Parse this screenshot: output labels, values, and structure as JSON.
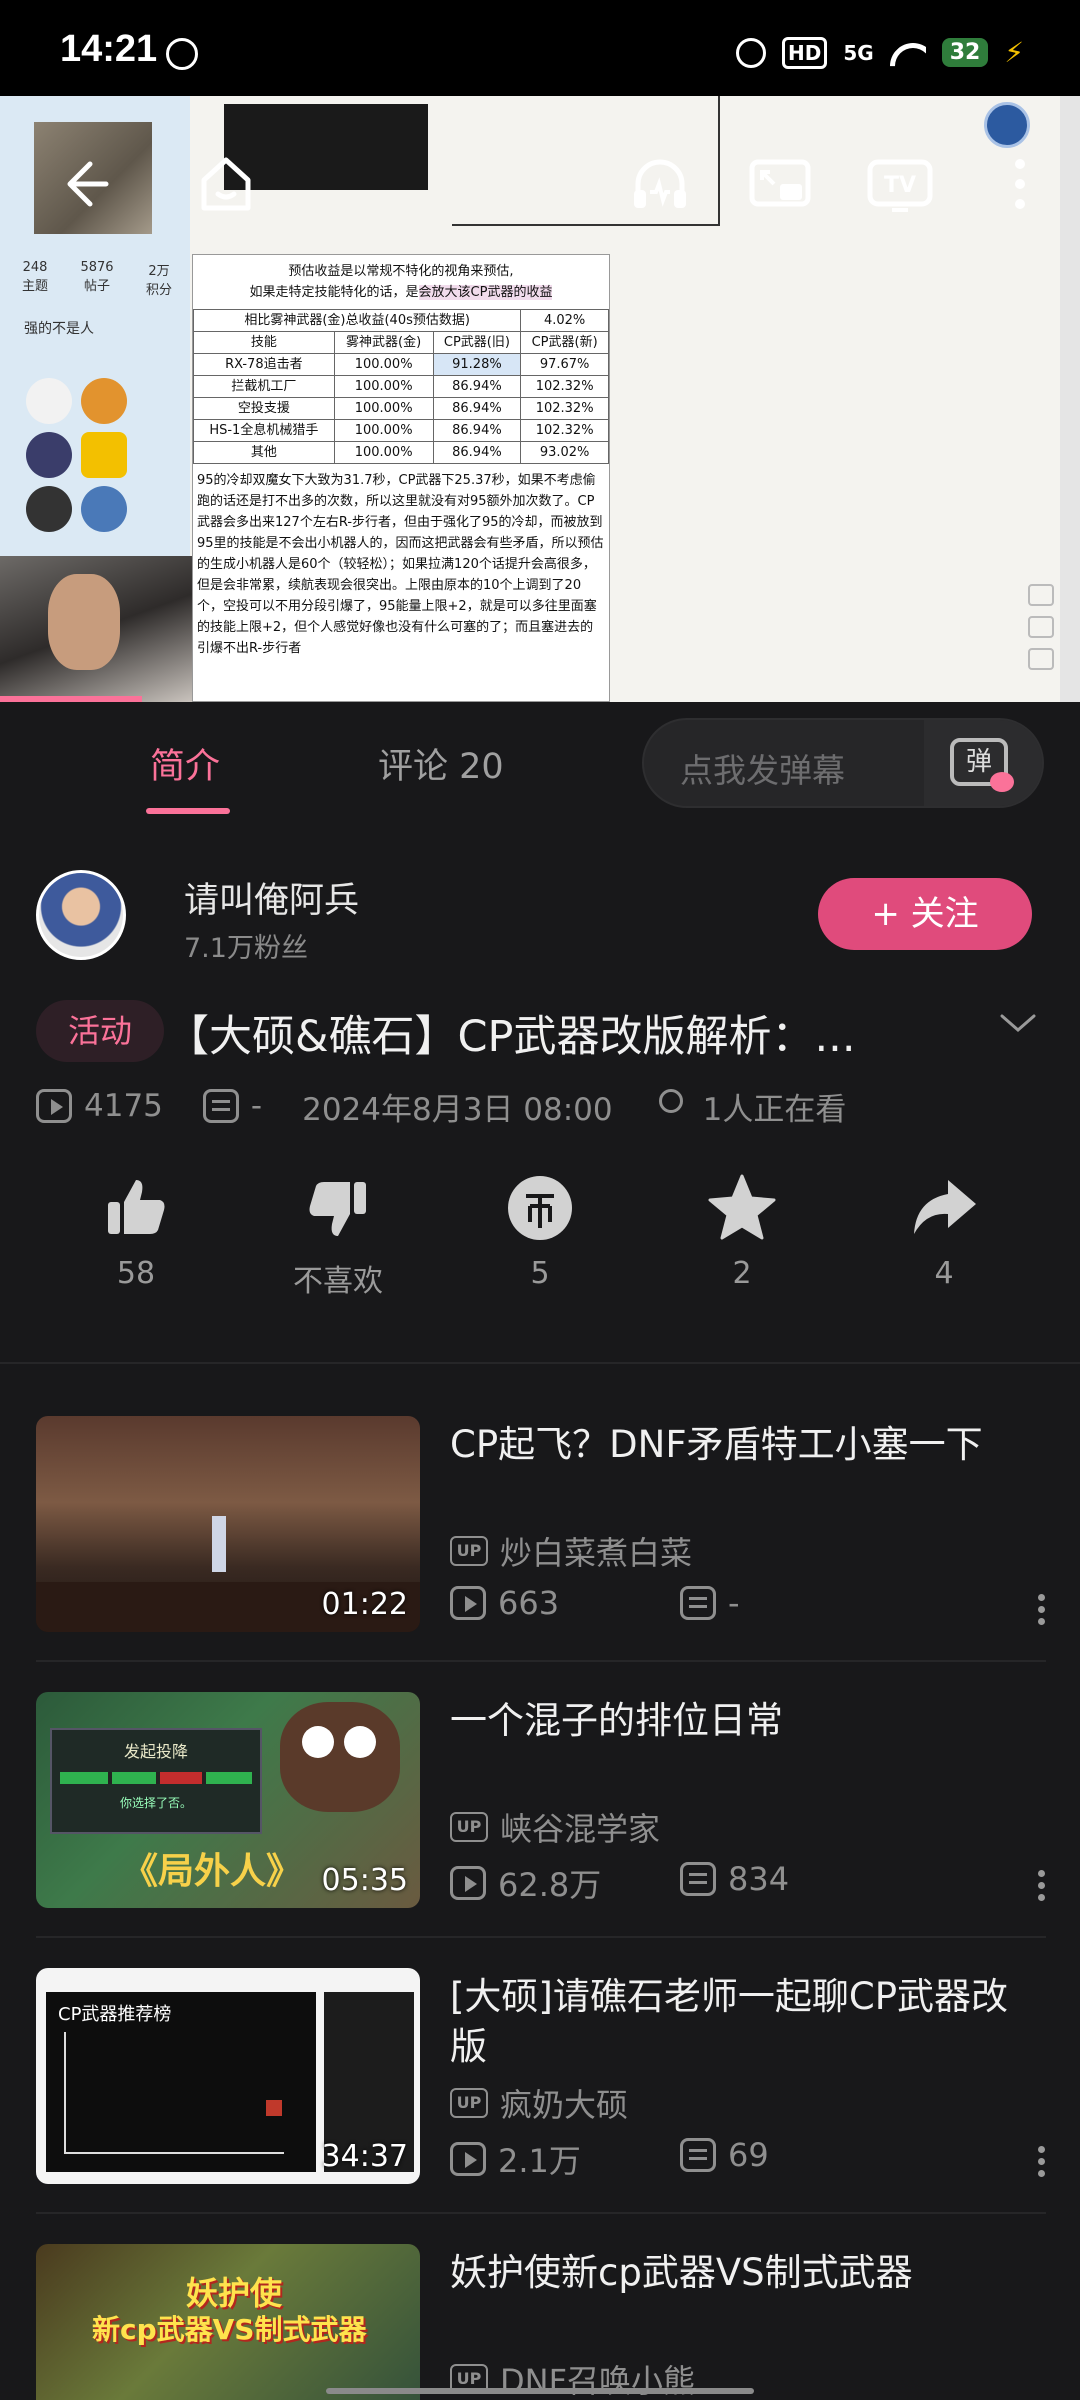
{
  "status_bar": {
    "time": "14:21",
    "network": "5G",
    "hd_label": "HD",
    "battery": "32",
    "battery_color": "#2f7d3b"
  },
  "video": {
    "forum": {
      "stats": [
        {
          "value": "248",
          "label": "主题"
        },
        {
          "value": "5876",
          "label": "帖子"
        },
        {
          "value": "2万",
          "label": "积分"
        }
      ],
      "username": "强的不是人"
    },
    "doc": {
      "note_line1": "预估收益是以常规不特化的视角来预估,",
      "note_line2_prefix": "如果走特定技能特化的话，是",
      "note_line2_highlight": "会放大该CP武器的收益",
      "table_title": "相比雾神武器(金)总收益(40s预估数据)",
      "table_title_value": "4.02%",
      "headers": [
        "技能",
        "雾神武器(金)",
        "CP武器(旧)",
        "CP武器(新)"
      ],
      "rows": [
        [
          "RX-78追击者",
          "100.00%",
          "91.28%",
          "97.67%"
        ],
        [
          "拦截机工厂",
          "100.00%",
          "86.94%",
          "102.32%"
        ],
        [
          "空投支援",
          "100.00%",
          "86.94%",
          "102.32%"
        ],
        [
          "HS-1全息机械猎手",
          "100.00%",
          "86.94%",
          "102.32%"
        ],
        [
          "其他",
          "100.00%",
          "86.94%",
          "93.02%"
        ]
      ],
      "body": "95的冷却双魔女下大致为31.7秒，CP武器下25.37秒，如果不考虑偷跑的话还是打不出多的次数，所以这里就没有对95额外加次数了。CP武器会多出来127个左右R-步行者，但由于强化了95的冷却，而被放到95里的技能是不会出小机器人的，因而这把武器会有些矛盾，所以预估的生成小机器人是60个（较轻松）；如果拉满120个话提升会高很多，但是会非常累，续航表现会很突出。上限由原本的10个上调到了20个，空投可以不用分段引爆了，95能量上限+2，就是可以多往里面塞的技能上限+2，但个人感觉好像也没有什么可塞的了；而且塞进去的引爆不出R-步行者"
    },
    "controls": [
      "back-icon",
      "home-icon",
      "audio-icon",
      "pip-icon",
      "cast-tv-icon",
      "more-icon"
    ]
  },
  "tabs": {
    "intro": "简介",
    "comments": "评论 20",
    "danmu_placeholder": "点我发弹幕",
    "danmu_button": "弹",
    "accent": "#fb7299"
  },
  "uploader": {
    "name": "请叫俺阿兵",
    "fans": "7.1万粉丝",
    "follow_label": "+ 关注",
    "follow_color": "#e04b7c"
  },
  "video_info": {
    "tag": "活动",
    "title": "【大硕&礁石】CP武器改版解析：...",
    "views": "4175",
    "danmaku": "-",
    "date": "2024年8月3日 08:00",
    "watching": "1人正在看"
  },
  "actions": [
    {
      "icon": "thumbs-up-icon",
      "label": "58"
    },
    {
      "icon": "thumbs-down-icon",
      "label": "不喜欢"
    },
    {
      "icon": "coin-icon",
      "label": "5"
    },
    {
      "icon": "star-icon",
      "label": "2"
    },
    {
      "icon": "share-icon",
      "label": "4"
    }
  ],
  "recommendations": [
    {
      "title": "CP起飞？DNF矛盾特工小塞一下",
      "uploader": "炒白菜煮白菜",
      "views": "663",
      "danmaku": "-",
      "duration": "01:22"
    },
    {
      "title": "一个混子的排位日常",
      "uploader": "峡谷混学家",
      "views": "62.8万",
      "danmaku": "834",
      "duration": "05:35"
    },
    {
      "title": "[大硕]请礁石老师一起聊CP武器改版",
      "uploader": "疯奶大硕",
      "views": "2.1万",
      "danmaku": "69",
      "duration": "34:37"
    },
    {
      "title": "妖护使新cp武器VS制式武器",
      "uploader": "DNF召唤小熊",
      "views": "",
      "danmaku": "",
      "duration": ""
    }
  ],
  "thumb_texts": {
    "rec2_overlay_top": "发起投降",
    "rec2_overlay_sub": "你选择了否。",
    "rec2_caption": "《局外人》",
    "rec3_caption": "CP武器推荐榜",
    "rec4_caption_line1": "妖护使",
    "rec4_caption_line2": "新cp武器VS制式武器"
  }
}
